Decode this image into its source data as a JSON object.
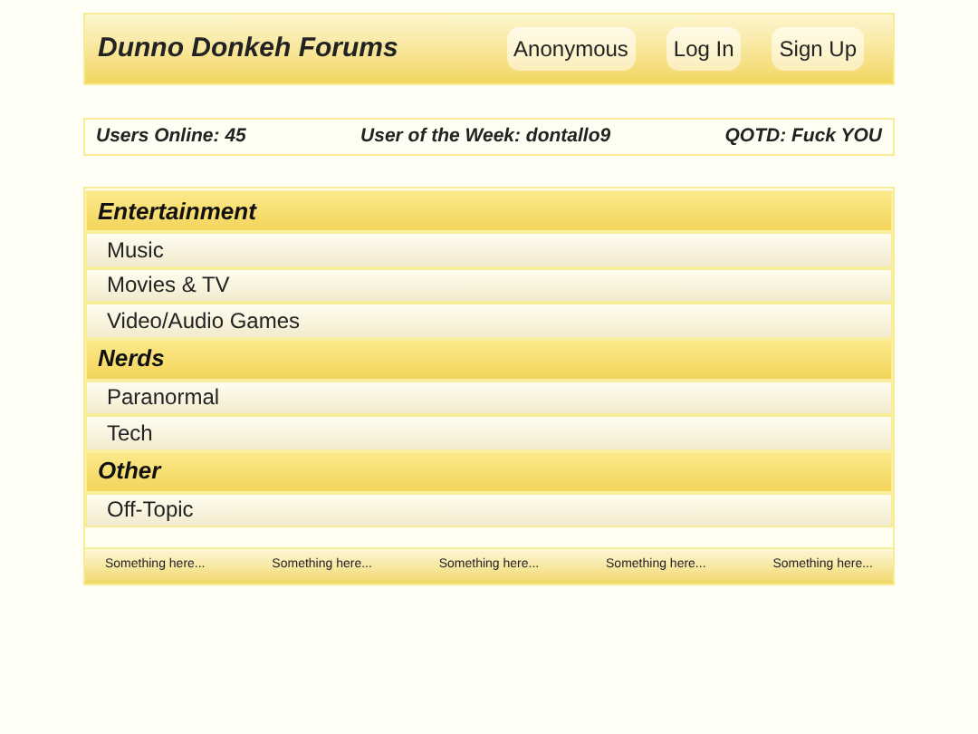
{
  "header": {
    "title": "Dunno Donkeh Forums",
    "buttons": [
      "Anonymous",
      "Log In",
      "Sign Up"
    ]
  },
  "stats": [
    "Users Online: 45",
    "User of the Week: dontallo9",
    "QOTD: Fuck YOU"
  ],
  "categories": [
    {
      "name": "Entertainment",
      "forums": [
        "Music",
        "Movies & TV",
        "Video/Audio Games"
      ]
    },
    {
      "name": "Nerds",
      "forums": [
        "Paranormal",
        "Tech"
      ]
    },
    {
      "name": "Other",
      "forums": [
        "Off-Topic"
      ]
    }
  ],
  "footer": [
    "Something here...",
    "Something here...",
    "Something here...",
    "Something here...",
    "Something here..."
  ]
}
